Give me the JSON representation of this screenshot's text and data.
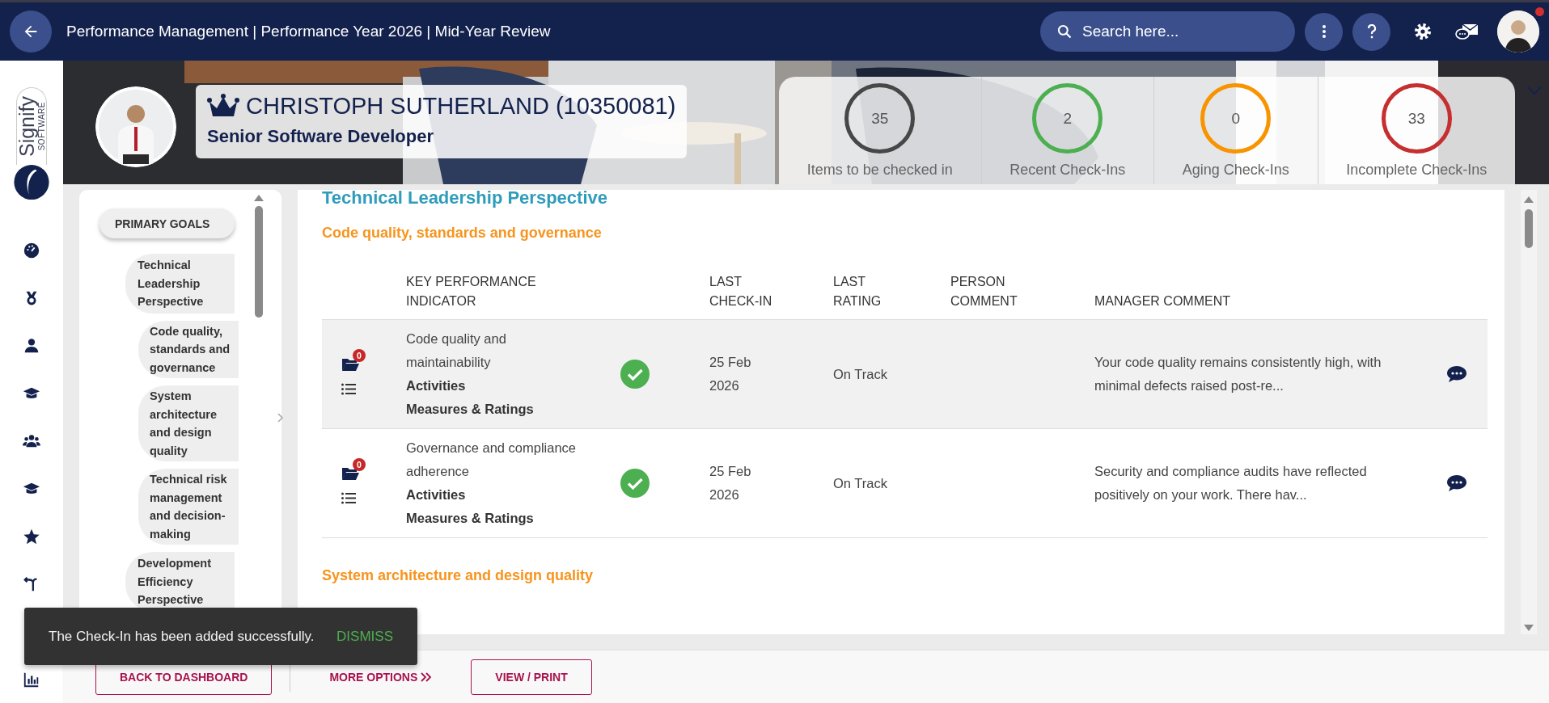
{
  "topbar": {
    "title": "Performance Management | Performance Year 2026 | Mid-Year Review",
    "search": {
      "placeholder": "Search here..."
    },
    "profile_alert": true
  },
  "brand": {
    "name": "Signify",
    "tagline": "SOFTWARE"
  },
  "employee": {
    "name": "CHRISTOPH SUTHERLAND (10350081)",
    "role": "Senior Software Developer"
  },
  "stats": [
    {
      "value": "35",
      "label": "Items to be checked in",
      "color": "#474747"
    },
    {
      "value": "2",
      "label": "Recent Check-Ins",
      "color": "#4caf50"
    },
    {
      "value": "0",
      "label": "Aging Check-Ins",
      "color": "#f79400"
    },
    {
      "value": "33",
      "label": "Incomplete Check-Ins",
      "color": "#c62f2f"
    }
  ],
  "goal_nav": {
    "heading": "PRIMARY GOALS",
    "items": [
      {
        "label": "Technical Leadership Perspective",
        "children": [
          {
            "label": "Code quality, standards and governance"
          },
          {
            "label": "System architecture and design quality"
          },
          {
            "label": "Technical risk management and decision-making"
          }
        ]
      },
      {
        "label": "Development Efficiency Perspective"
      }
    ]
  },
  "section": {
    "title": "Technical Leadership Perspective",
    "goals": [
      {
        "title": "Code quality, standards and governance",
        "columns": [
          "KEY PERFORMANCE INDICATOR",
          "LAST CHECK-IN",
          "LAST RATING",
          "PERSON COMMENT",
          "MANAGER COMMENT"
        ],
        "rows": [
          {
            "kpi": "Code quality and maintainability",
            "links": [
              "Activities",
              "Measures & Ratings"
            ],
            "attachments": "0",
            "completed": true,
            "last_check_in": "25 Feb 2026",
            "last_rating": "On Track",
            "manager_comment": "Your code quality remains consistently high, with minimal defects raised post-re...",
            "highlighted": true
          },
          {
            "kpi": "Governance and compliance adherence",
            "links": [
              "Activities",
              "Measures & Ratings"
            ],
            "attachments": "0",
            "completed": true,
            "last_check_in": "25 Feb 2026",
            "last_rating": "On Track",
            "manager_comment": "Security and compliance audits have reflected positively on your work. There hav...",
            "highlighted": false
          }
        ]
      },
      {
        "title": "System architecture and design quality"
      }
    ]
  },
  "footer": {
    "buttons": [
      {
        "label": "BACK TO DASHBOARD",
        "kind": "outlined"
      },
      {
        "label": "MORE OPTIONS",
        "kind": "text"
      },
      {
        "label": "VIEW / PRINT",
        "kind": "outlined"
      }
    ]
  },
  "snackbar": {
    "message": "The Check-In has been added successfully.",
    "action": "DISMISS"
  }
}
